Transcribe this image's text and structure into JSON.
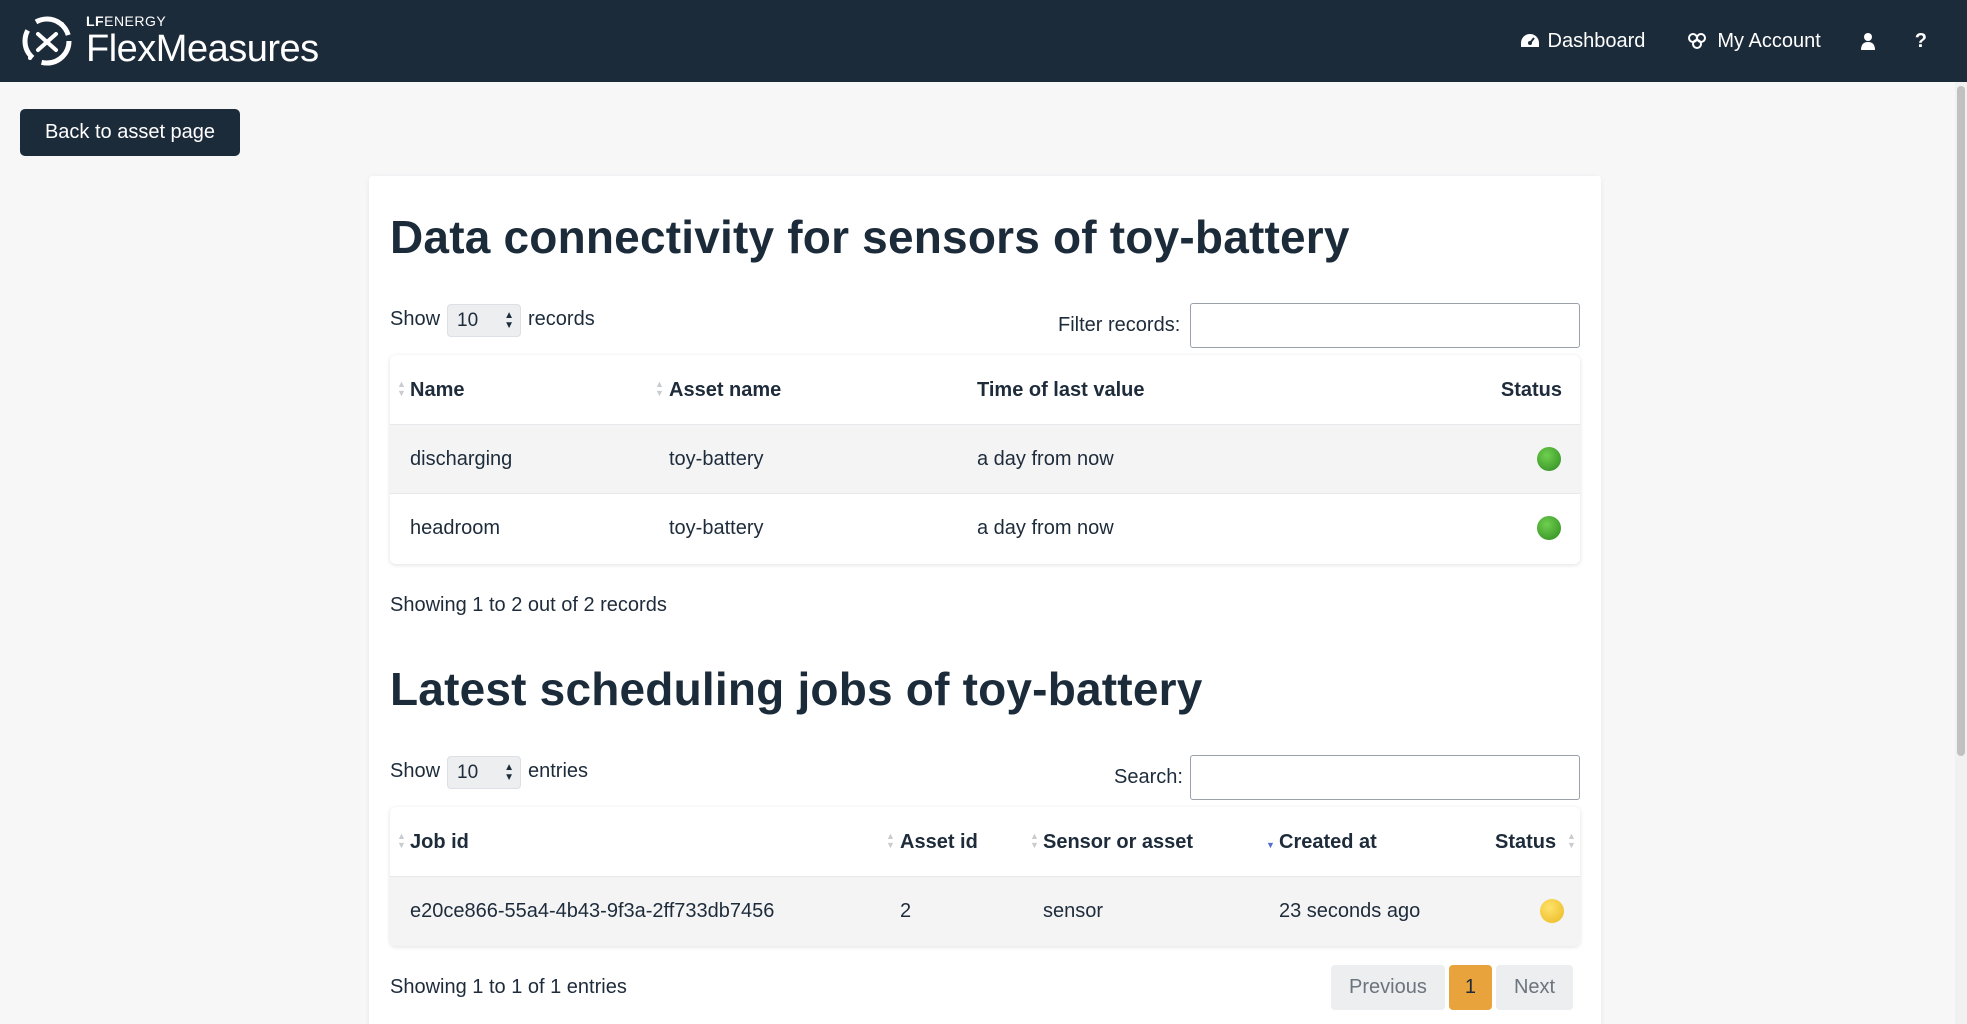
{
  "navbar": {
    "brand_top_bold": "LF",
    "brand_top_thin": "ENERGY",
    "brand_main": "FlexMeasures",
    "dashboard_label": "Dashboard",
    "account_label": "My Account",
    "help_label": "?"
  },
  "back_button": "Back to asset page",
  "connectivity": {
    "title": "Data connectivity for sensors of toy-battery",
    "show_label": "Show",
    "show_value": "10",
    "show_suffix": "records",
    "filter_label": "Filter records:",
    "filter_value": "",
    "columns": [
      "Name",
      "Asset name",
      "Time of last value",
      "Status"
    ],
    "rows": [
      {
        "name": "discharging",
        "asset": "toy-battery",
        "time": "a day from now",
        "status": "green"
      },
      {
        "name": "headroom",
        "asset": "toy-battery",
        "time": "a day from now",
        "status": "green"
      }
    ],
    "summary": "Showing 1 to 2 out of 2 records"
  },
  "jobs": {
    "title": "Latest scheduling jobs of toy-battery",
    "show_label": "Show",
    "show_value": "10",
    "show_suffix": "entries",
    "search_label": "Search:",
    "search_value": "",
    "columns": [
      "Job id",
      "Asset id",
      "Sensor or asset",
      "Created at",
      "Status"
    ],
    "rows": [
      {
        "job_id": "e20ce866-55a4-4b43-9f3a-2ff733db7456",
        "asset_id": "2",
        "sensor_or_asset": "sensor",
        "created_at": "23 seconds ago",
        "status": "yellow"
      }
    ],
    "summary": "Showing 1 to 1 of 1 entries",
    "pagination": {
      "previous": "Previous",
      "current": "1",
      "next": "Next"
    }
  },
  "colors": {
    "navbar_bg": "#1c2b3a",
    "status_green": "#3a9a2a",
    "status_yellow": "#f3c530",
    "active_page": "#e8a33d"
  }
}
